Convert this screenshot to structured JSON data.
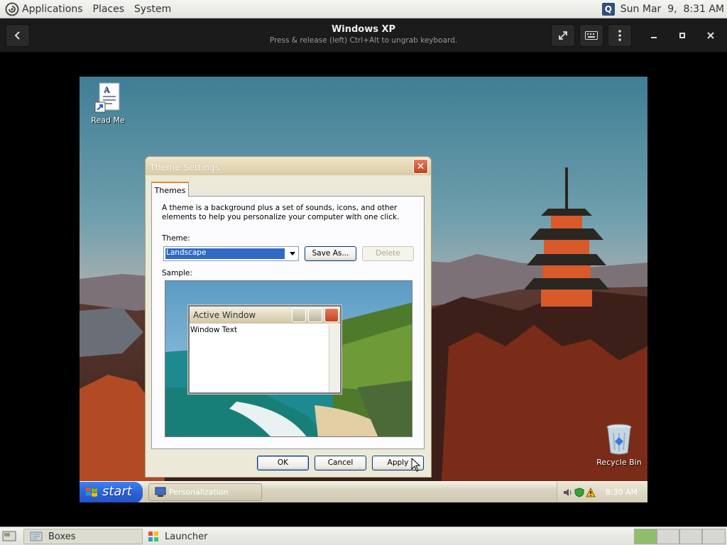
{
  "top_panel": {
    "menus": [
      "Applications",
      "Places",
      "System"
    ],
    "clock": "Sun Mar  9,  8:31 AM"
  },
  "boxes": {
    "title": "Windows XP",
    "subtitle": "Press & release (left) Ctrl+Alt to ungrab keyboard."
  },
  "desktop": {
    "icons": [
      {
        "label": "Read Me",
        "icon": "document-shortcut-icon"
      },
      {
        "label": "Recycle Bin",
        "icon": "recycle-bin-icon"
      }
    ]
  },
  "dialog": {
    "title": "Theme Settings",
    "tab": "Themes",
    "description": "A theme is a background plus a set of sounds, icons, and other elements to help you personalize your computer with one click.",
    "theme_label": "Theme:",
    "theme_value": "Landscape",
    "save_as": "Save As...",
    "delete": "Delete",
    "sample_label": "Sample:",
    "sample": {
      "window_title": "Active Window",
      "window_text": "Window Text"
    },
    "ok": "OK",
    "cancel": "Cancel",
    "apply": "Apply"
  },
  "xp_taskbar": {
    "start": "start",
    "task": "Personalization",
    "clock": "8:30 AM"
  },
  "bottom_panel": {
    "tasks": [
      "Boxes",
      "Launcher"
    ]
  },
  "colors": {
    "xp_start": "#2b63d9",
    "selection": "#316ac5",
    "workspace_active": "#8fbf6a"
  }
}
